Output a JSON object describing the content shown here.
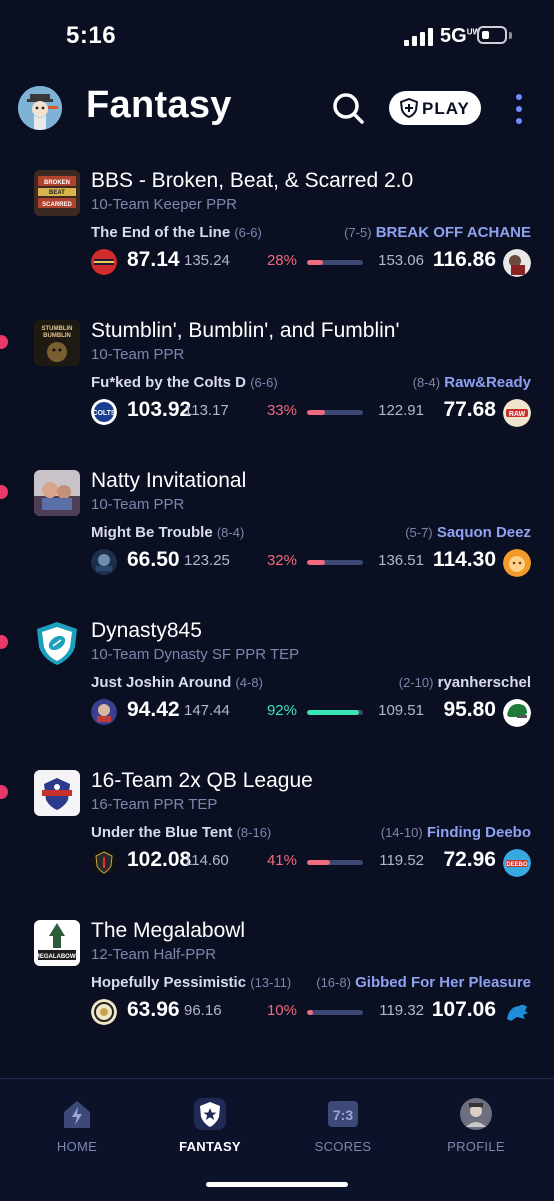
{
  "status": {
    "time": "5:16",
    "network": "5G",
    "network_sup": "UW"
  },
  "header": {
    "title": "Fantasy",
    "play_label": "PLAY"
  },
  "leagues": [
    {
      "name": "BBS - Broken, Beat, & Scarred 2.0",
      "type": "10-Team Keeper PPR",
      "unread": false,
      "left_team": "The End of the Line",
      "left_record": "(6-6)",
      "right_team": "BREAK OFF ACHANE",
      "right_record": "(7-5)",
      "left_score": "87.14",
      "left_proj": "135.24",
      "win_pct": "28%",
      "win_pct_value": 28,
      "pct_color": "red",
      "right_proj": "153.06",
      "right_score": "116.86"
    },
    {
      "name": "Stumblin', Bumblin', and Fumblin'",
      "type": "10-Team PPR",
      "unread": true,
      "left_team": "Fu*ked by the Colts D",
      "left_record": "(6-6)",
      "right_team": "Raw&Ready",
      "right_record": "(8-4)",
      "left_score": "103.92",
      "left_proj": "113.17",
      "win_pct": "33%",
      "win_pct_value": 33,
      "pct_color": "red",
      "right_proj": "122.91",
      "right_score": "77.68"
    },
    {
      "name": "Natty Invitational",
      "type": "10-Team PPR",
      "unread": true,
      "left_team": "Might Be Trouble",
      "left_record": "(8-4)",
      "right_team": "Saquon Deez",
      "right_record": "(5-7)",
      "left_score": "66.50",
      "left_proj": "123.25",
      "win_pct": "32%",
      "win_pct_value": 32,
      "pct_color": "red",
      "right_proj": "136.51",
      "right_score": "114.30"
    },
    {
      "name": "Dynasty845",
      "type": "10-Team Dynasty SF PPR TEP",
      "unread": true,
      "left_team": "Just Joshin Around",
      "left_record": "(4-8)",
      "right_team": "ryanherschel",
      "right_record": "(2-10)",
      "left_score": "94.42",
      "left_proj": "147.44",
      "win_pct": "92%",
      "win_pct_value": 92,
      "pct_color": "green",
      "right_proj": "109.51",
      "right_score": "95.80"
    },
    {
      "name": "16-Team 2x QB League",
      "type": "16-Team PPR TEP",
      "unread": true,
      "left_team": "Under the Blue Tent",
      "left_record": "(8-16)",
      "right_team": "Finding Deebo",
      "right_record": "(14-10)",
      "left_score": "102.08",
      "left_proj": "114.60",
      "win_pct": "41%",
      "win_pct_value": 41,
      "pct_color": "red",
      "right_proj": "119.52",
      "right_score": "72.96"
    },
    {
      "name": "The Megalabowl",
      "type": "12-Team Half-PPR",
      "unread": false,
      "left_team": "Hopefully Pessimistic",
      "left_record": "(13-11)",
      "right_team": "Gibbed For Her Pleasure",
      "right_record": "(16-8)",
      "left_score": "63.96",
      "left_proj": "96.16",
      "win_pct": "10%",
      "win_pct_value": 10,
      "pct_color": "red",
      "right_proj": "119.32",
      "right_score": "107.06"
    }
  ],
  "logo_text": {
    "bbs": "BROKEN BEAT & SCARRED",
    "stumblin": "STUMBLIN BUMBLIN FUMBLIN",
    "megalabowl": "MEGALABOWL",
    "scores_tab_icon": "7:3",
    "deebo": "DEEBO",
    "raw": "RAW",
    "colts": "COLTS"
  },
  "tabs": [
    {
      "label": "HOME",
      "icon": "home-icon"
    },
    {
      "label": "FANTASY",
      "icon": "fantasy-icon"
    },
    {
      "label": "SCORES",
      "icon": "scores-icon"
    },
    {
      "label": "PROFILE",
      "icon": "profile-icon"
    }
  ],
  "colors": {
    "background": "#0b0f22",
    "accent": "#8fa2f2",
    "loss": "#f06a7e",
    "win": "#39e6b4",
    "unread": "#e8396a"
  }
}
